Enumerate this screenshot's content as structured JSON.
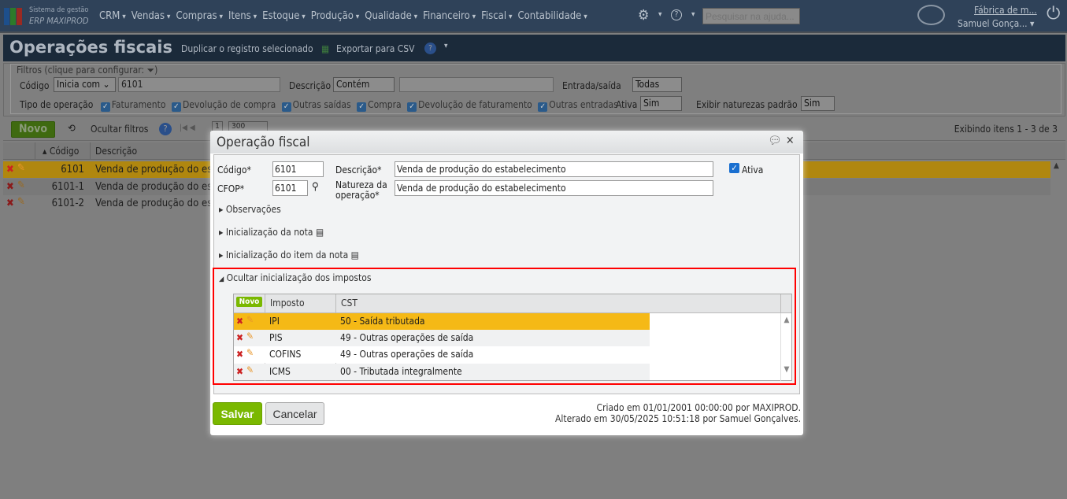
{
  "app": {
    "brand_line1": "Sistema de gestão",
    "brand_line2": "ERP MAXIPROD",
    "menu": [
      "CRM",
      "Vendas",
      "Compras",
      "Itens",
      "Estoque",
      "Produção",
      "Qualidade",
      "Financeiro",
      "Fiscal",
      "Contabilidade"
    ],
    "help_search_placeholder": "Pesquisar na ajuda...",
    "company": "Fábrica de m...",
    "user": "Samuel Gonça..."
  },
  "page": {
    "title": "Operações fiscais",
    "duplicate": "Duplicar o registro selecionado",
    "export": "Exportar para CSV"
  },
  "filters": {
    "legend": "Filtros (clique para configurar:",
    "codigo_label": "Código",
    "codigo_op": "Inicia com",
    "codigo_value": "6101",
    "descricao_label": "Descrição",
    "descricao_op": "Contém",
    "descricao_value": "",
    "entrada_label": "Entrada/saída",
    "entrada_value": "Todas",
    "tipo_label": "Tipo de operação",
    "tipos": [
      "Faturamento",
      "Devolução de compra",
      "Outras saídas",
      "Compra",
      "Devolução de faturamento",
      "Outras entradas"
    ],
    "ativa_label": "Ativa",
    "ativa_value": "Sim",
    "naturezas_label": "Exibir naturezas padrão",
    "naturezas_value": "Sim"
  },
  "toolbar": {
    "novo": "Novo",
    "ocultar": "Ocultar filtros",
    "page": "1",
    "page_size": "300",
    "displaying": "Exibindo itens 1 - 3 de 3"
  },
  "grid": {
    "columns": [
      "Código",
      "Descrição"
    ],
    "rows": [
      {
        "codigo": "6101",
        "descricao": "Venda de produção do esta"
      },
      {
        "codigo": "6101-1",
        "descricao": "Venda de produção do esta"
      },
      {
        "codigo": "6101-2",
        "descricao": "Venda de produção do esta"
      }
    ]
  },
  "modal": {
    "title": "Operação fiscal",
    "codigo_label": "Código*",
    "codigo": "6101",
    "descricao_label": "Descrição*",
    "descricao": "Venda de produção do estabelecimento",
    "ativa_label": "Ativa",
    "cfop_label": "CFOP*",
    "cfop": "6101",
    "natureza_label1": "Natureza da",
    "natureza_label2": "operação*",
    "natureza": "Venda de produção do estabelecimento",
    "sections": [
      "Observações",
      "Inicialização da nota",
      "Inicialização do item da nota"
    ],
    "impostos_section": "Ocultar inicialização dos impostos",
    "tax_grid": {
      "novo": "Novo",
      "columns": [
        "Imposto",
        "CST"
      ],
      "rows": [
        {
          "imposto": "IPI",
          "cst": "50 - Saída tributada"
        },
        {
          "imposto": "PIS",
          "cst": "49 - Outras operações de saída"
        },
        {
          "imposto": "COFINS",
          "cst": "49 - Outras operações de saída"
        },
        {
          "imposto": "ICMS",
          "cst": "00 - Tributada integralmente"
        }
      ]
    },
    "save": "Salvar",
    "cancel": "Cancelar",
    "created": "Criado em 01/01/2001 00:00:00 por MAXIPROD.",
    "modified": "Alterado em 30/05/2025 10:51:18 por Samuel Gonçalves."
  },
  "colors": {
    "accent_green": "#7ab800",
    "selected_row": "#f5b916",
    "highlight": "#ff0000"
  }
}
